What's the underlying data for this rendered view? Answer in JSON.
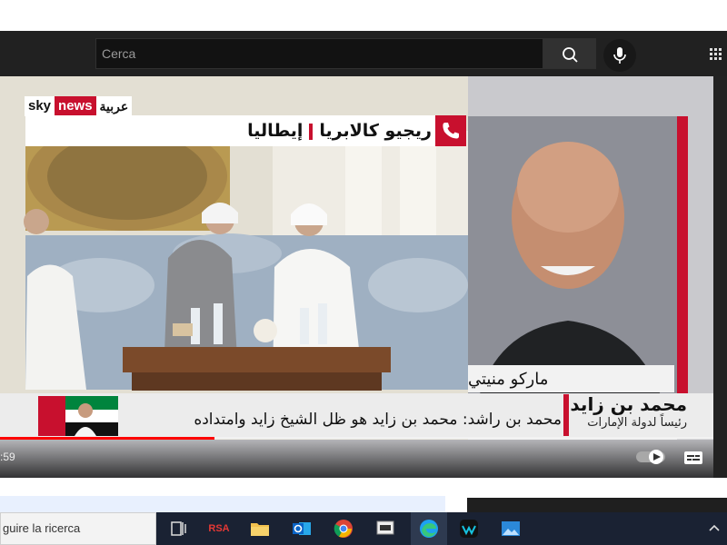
{
  "browser": {
    "search": {
      "placeholder": "Cerca"
    },
    "icons": [
      "search-icon",
      "mic-icon",
      "apps-grid-icon"
    ]
  },
  "video": {
    "channel_logo": {
      "sky": "sky",
      "news": "news",
      "arabic": "عربية"
    },
    "location": {
      "city": "ريجيو كالابريا",
      "country": "إيطاليا"
    },
    "guest_name": "ماركو منيتي",
    "headline": "محمد بن راشد: محمد بن زايد هو ظل الشيخ زايد وامتداده",
    "leader_name": "محمد بن زايد",
    "leader_title": "رئيساً لدولة الإمارات",
    "time_display": ":59",
    "progress_fraction": 0.3,
    "accent_color": "#c8102e"
  },
  "taskbar": {
    "search_text": "guire la ricerca",
    "rsa_label": "RSA",
    "icons": [
      "task-view-icon",
      "rsa-icon",
      "file-explorer-icon",
      "outlook-icon",
      "chrome-icon",
      "generic-app-icon",
      "edge-icon",
      "webex-icon",
      "photos-icon",
      "chevron-up-icon"
    ]
  }
}
